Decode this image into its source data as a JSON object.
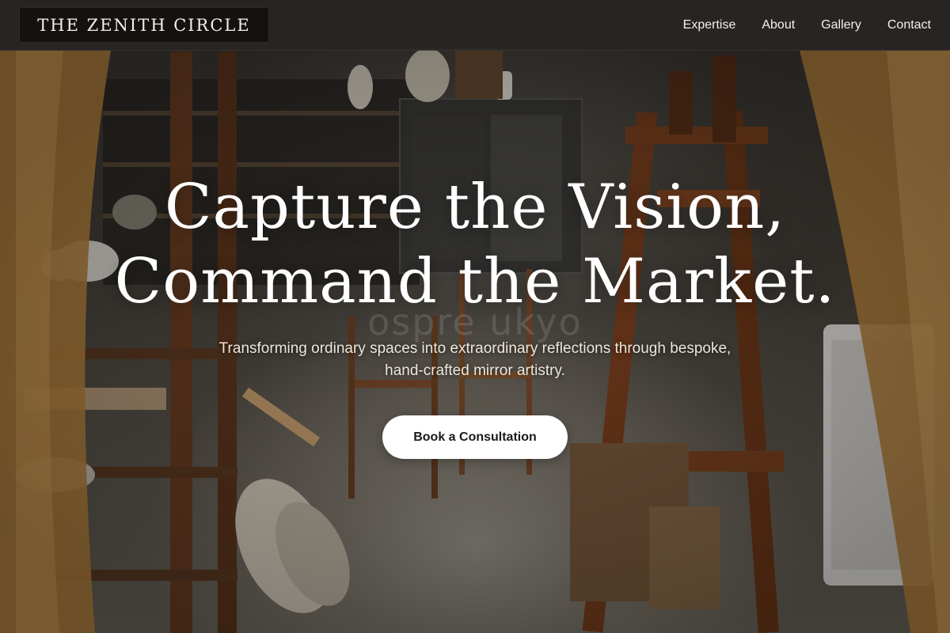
{
  "site": {
    "logo_text": "THE ZENITH CIRCLE"
  },
  "nav": {
    "items": [
      {
        "label": "Expertise"
      },
      {
        "label": "About"
      },
      {
        "label": "Gallery"
      },
      {
        "label": "Contact"
      }
    ]
  },
  "hero": {
    "headline_line1": "Capture the Vision,",
    "headline_line2": "Command the Market.",
    "subtitle": "Transforming ordinary spaces into extraordinary reflections through bespoke, hand-crafted mirror artistry.",
    "cta_label": "Book a Consultation",
    "watermark_text": "ospre  ukyo",
    "background_image": "antique-workshop-photo"
  },
  "colors": {
    "nav_background": "#282522",
    "logo_background": "#141210",
    "headline_text": "#ffffff",
    "cta_background": "#ffffff",
    "cta_text": "#1a1a1a"
  }
}
